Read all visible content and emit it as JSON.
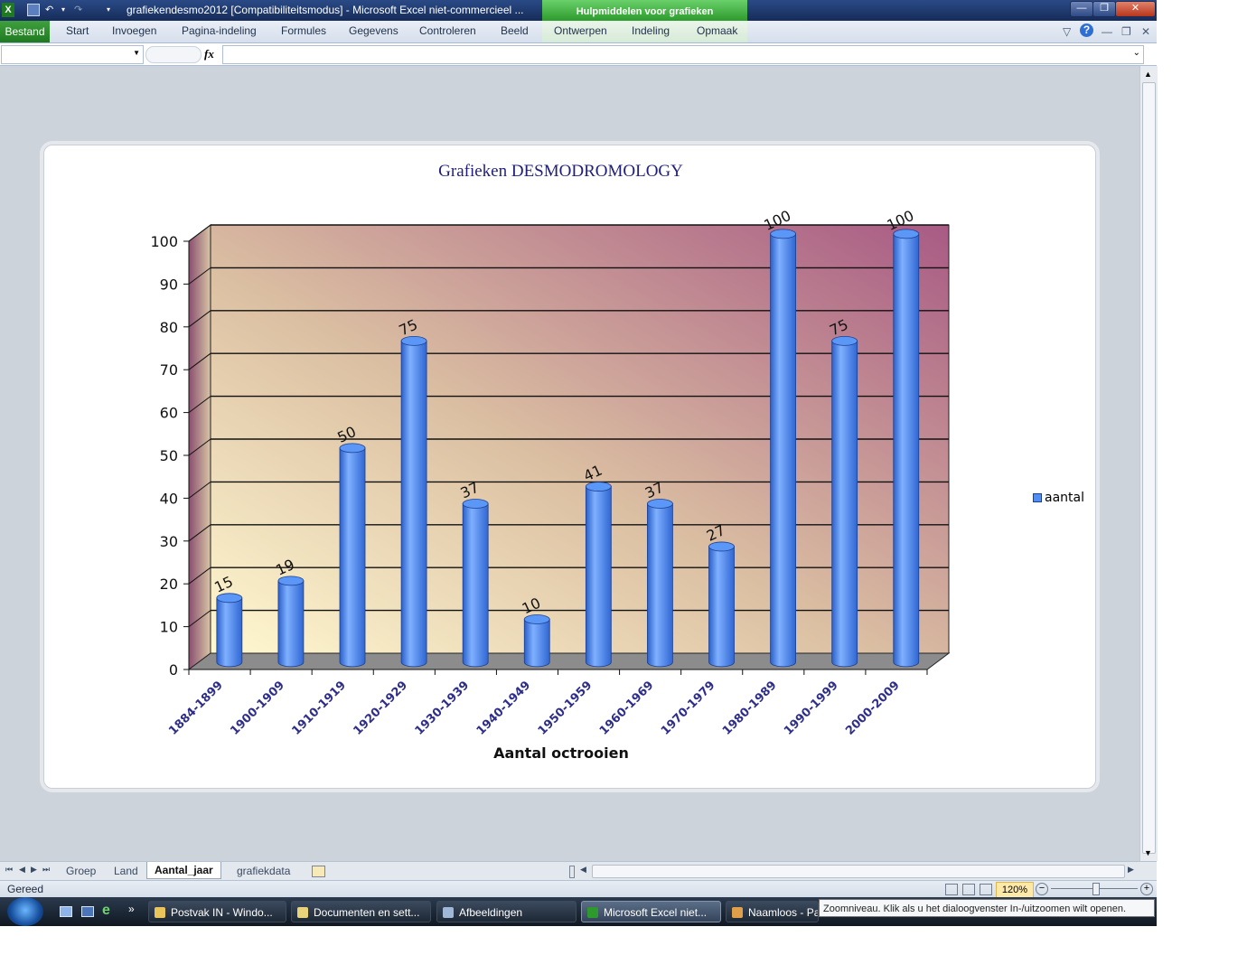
{
  "titlebar": {
    "title": "grafiekendesmo2012  [Compatibiliteitsmodus]  -  Microsoft Excel niet-commercieel ...",
    "context_group": "Hulpmiddelen voor grafieken"
  },
  "ribbon": {
    "file_tab": "Bestand",
    "tabs": [
      "Start",
      "Invoegen",
      "Pagina-indeling",
      "Formules",
      "Gegevens",
      "Controleren",
      "Beeld"
    ],
    "context_tabs": [
      "Ontwerpen",
      "Indeling",
      "Opmaak"
    ]
  },
  "formula_bar": {
    "fx_label": "fx",
    "name_box": "",
    "formula": ""
  },
  "colors": {
    "bar": "#4f8ef2",
    "title": "#1f1f7a",
    "tick_label": "#2e2e8a"
  },
  "chart_data": {
    "type": "bar",
    "title": "Grafieken DESMODROMOLOGY",
    "xlabel": "Aantal octrooien",
    "ylabel": "",
    "ylim": [
      0,
      100
    ],
    "yticks": [
      "0",
      "10",
      "20",
      "30",
      "40",
      "50",
      "60",
      "70",
      "80",
      "90",
      "100"
    ],
    "grid": true,
    "legend_position": "right",
    "categories": [
      "1884-1899",
      "1900-1909",
      "1910-1919",
      "1920-1929",
      "1930-1939",
      "1940-1949",
      "1950-1959",
      "1960-1969",
      "1970-1979",
      "1980-1989",
      "1990-1999",
      "2000-2009"
    ],
    "series": [
      {
        "name": "aantal",
        "values": [
          15,
          19,
          50,
          75,
          37,
          10,
          41,
          37,
          27,
          100,
          75,
          100
        ]
      }
    ]
  },
  "sheets": {
    "tabs": [
      "Groep",
      "Land",
      "Aantal_jaar",
      "grafiekdata"
    ],
    "active": "Aantal_jaar"
  },
  "status": {
    "ready": "Gereed",
    "zoom": "120%"
  },
  "taskbar": {
    "items": [
      "Postvak IN - Windo...",
      "Documenten en sett...",
      "Afbeeldingen",
      "Microsoft Excel niet...",
      "Naamloos - Pa"
    ]
  },
  "tooltip": "Zoomniveau. Klik als u het dialoogvenster In-/uitzoomen wilt openen."
}
